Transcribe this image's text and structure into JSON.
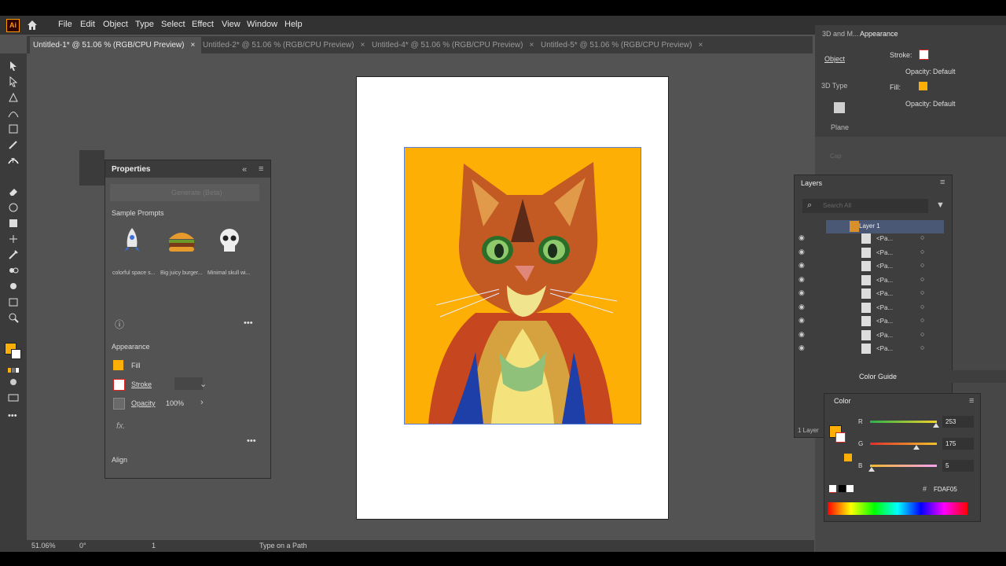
{
  "app": {
    "logo": "Ai"
  },
  "menu": [
    "File",
    "Edit",
    "Object",
    "Type",
    "Select",
    "Effect",
    "View",
    "Window",
    "Help"
  ],
  "tabs": [
    {
      "label": "Untitled-1* @ 51.06 % (RGB/CPU Preview)",
      "active": true
    },
    {
      "label": "Untitled-2* @ 51.06 % (RGB/CPU Preview)",
      "active": false
    },
    {
      "label": "Untitled-4* @ 51.06 % (RGB/CPU Preview)",
      "active": false
    },
    {
      "label": "Untitled-5* @ 51.06 % (RGB/CPU Preview)",
      "active": false
    }
  ],
  "tab_close": "×",
  "properties": {
    "title": "Properties",
    "generate": "Generate (Beta)",
    "sample_prompts": "Sample Prompts",
    "prompts": [
      "colorful space s...",
      "Big juicy burger...",
      "Minimal skull wi..."
    ],
    "appearance": "Appearance",
    "fill": "Fill",
    "stroke": "Stroke",
    "opacity": "Opacity",
    "opacity_value": "100%",
    "fx": "fx.",
    "align": "Align"
  },
  "appearance_panel": {
    "tabs": [
      "3D and M...",
      "Appearance"
    ],
    "side": [
      "Object",
      "3D Type",
      "Plane",
      "Cap"
    ],
    "stroke": "Stroke:",
    "fill": "Fill:",
    "opacity": "Opacity:",
    "default": "Default"
  },
  "layers": {
    "title": "Layers",
    "search_placeholder": "Search All",
    "layer_name": "Layer 1",
    "sublayers": [
      "<Pa...",
      "<Pa...",
      "<Pa...",
      "<Pa...",
      "<Pa...",
      "<Pa...",
      "<Pa...",
      "<Pa...",
      "<Pa..."
    ],
    "count": "1 Layer"
  },
  "color_guide": "Color Guide",
  "color": {
    "title": "Color",
    "R": "253",
    "G": "175",
    "B": "5",
    "r_fraction": 0.99,
    "g_fraction": 0.69,
    "b_fraction": 0.02,
    "hex": "FDAF05",
    "label_r": "R",
    "label_g": "G",
    "label_b": "B"
  },
  "status": {
    "zoom": "51.06%",
    "rotation": "0°",
    "page": "1",
    "tool": "Type on a Path"
  },
  "colors": {
    "fill": "#fdaf05",
    "accent": "#5b7fd8"
  }
}
